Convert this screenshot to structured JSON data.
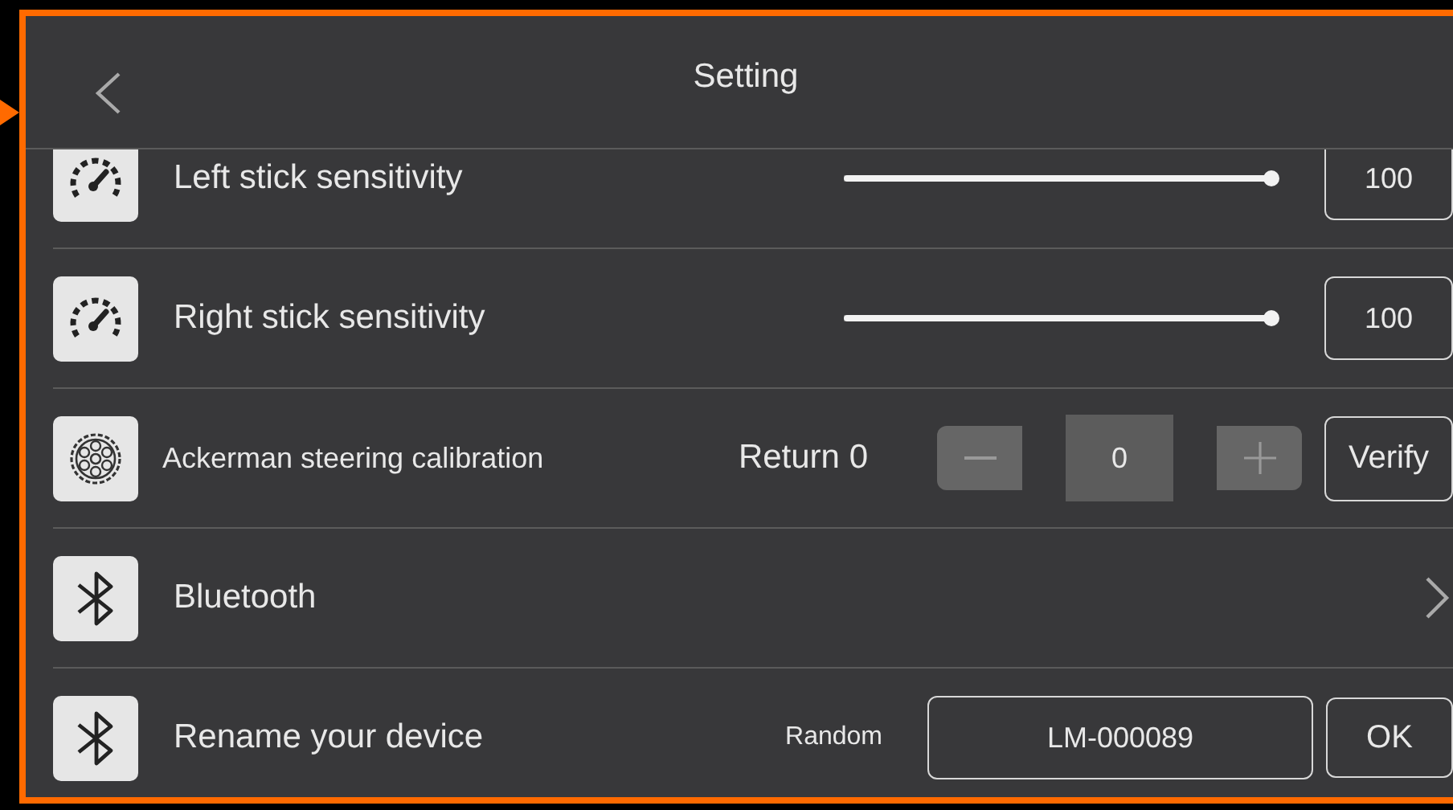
{
  "header": {
    "title": "Setting"
  },
  "rows": [
    {
      "kind": "slider",
      "label": "Left stick sensitivity",
      "level": 1,
      "value": "100"
    },
    {
      "kind": "slider",
      "label": "Right stick sensitivity",
      "level": 1,
      "value": "100"
    },
    {
      "kind": "stepper",
      "label": "Ackerman steering calibration",
      "action": "Return 0",
      "value": "0",
      "button": "Verify"
    },
    {
      "kind": "link",
      "label": "Bluetooth"
    },
    {
      "kind": "rename",
      "label": "Rename your device",
      "action": "Random",
      "value": "LM-000089",
      "button": "OK"
    }
  ]
}
